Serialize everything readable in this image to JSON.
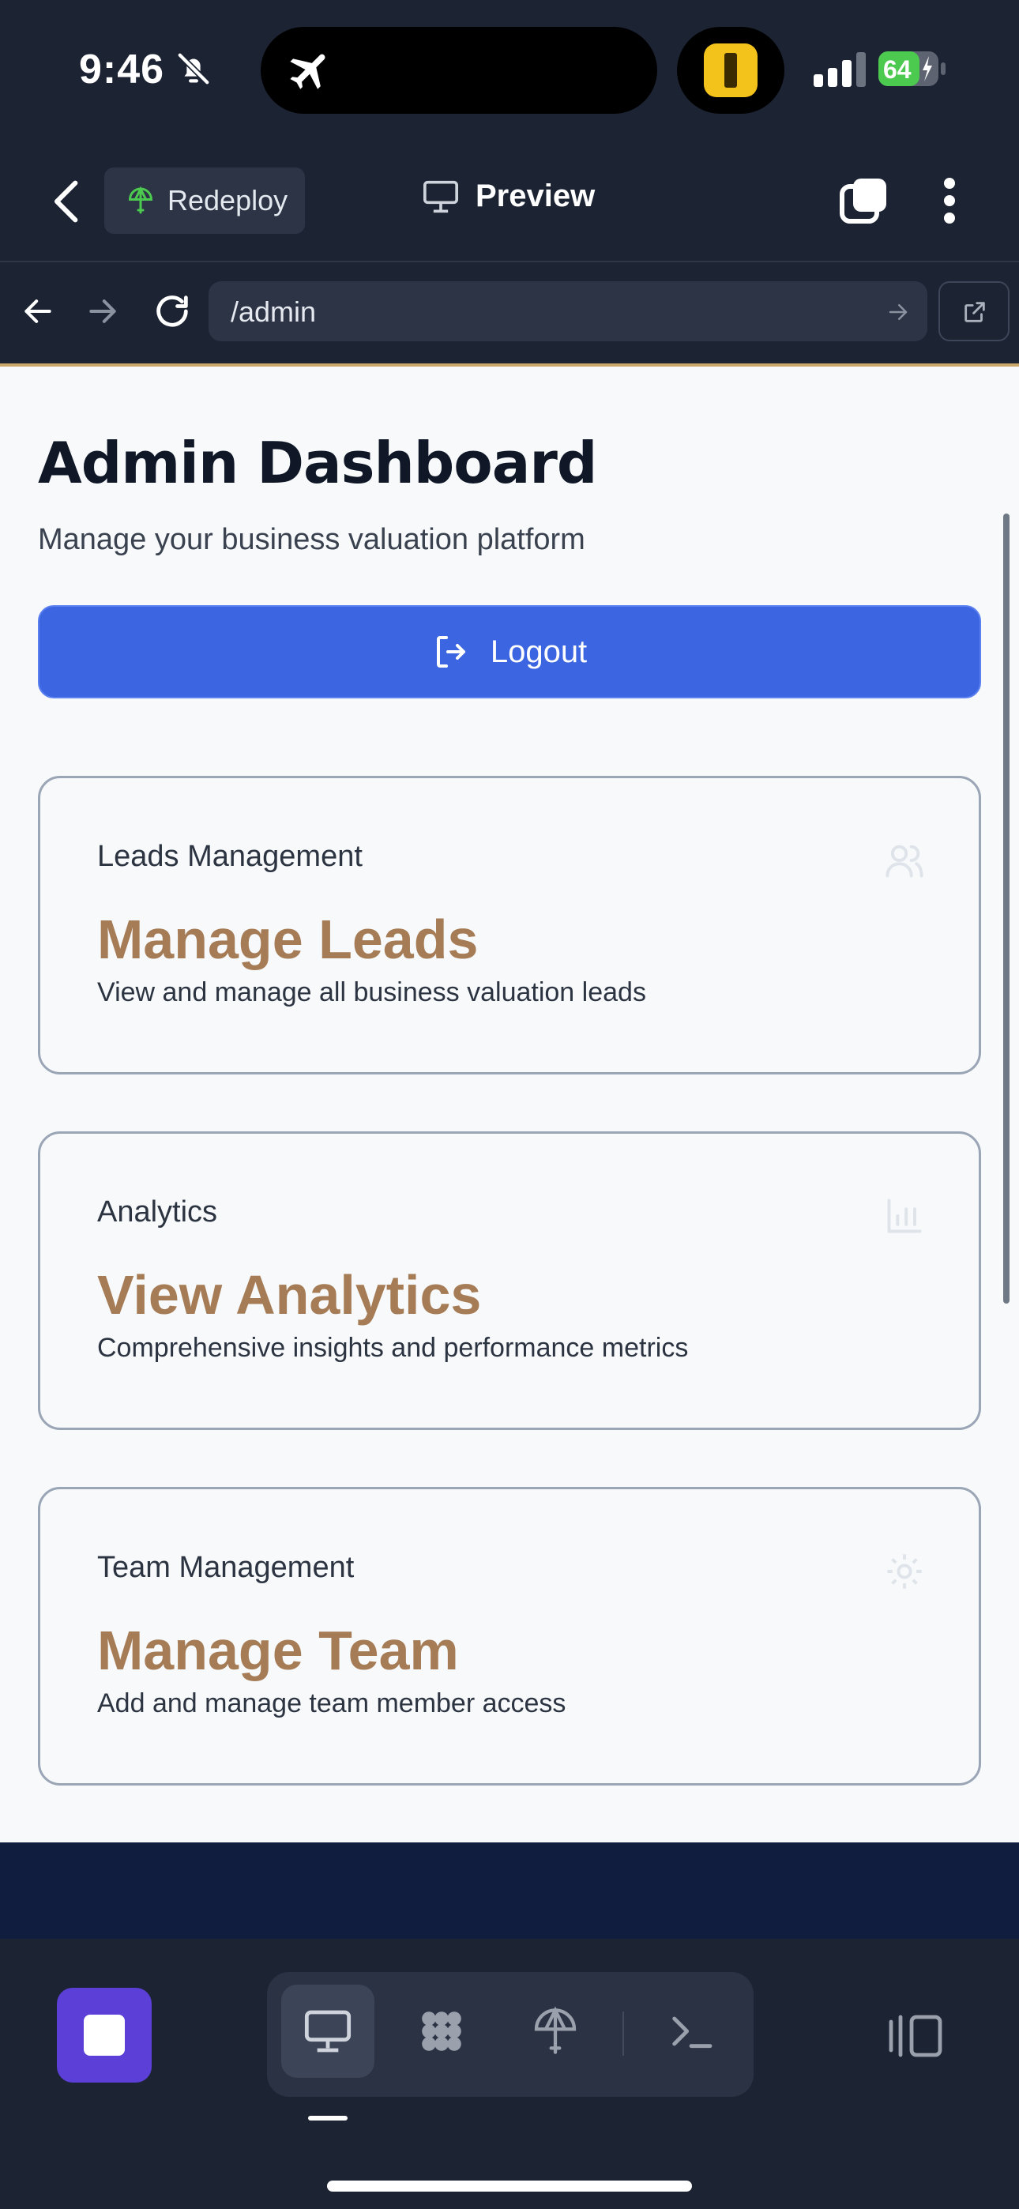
{
  "status_bar": {
    "time": "9:46",
    "battery": "64"
  },
  "header": {
    "redeploy_label": "Redeploy",
    "preview_label": "Preview"
  },
  "urlbar": {
    "url": "/admin"
  },
  "page": {
    "title": "Admin Dashboard",
    "subtitle": "Manage your business valuation platform",
    "logout_label": "Logout",
    "cards": [
      {
        "label": "Leads Management",
        "title": "Manage Leads",
        "desc": "View and manage all business valuation leads",
        "icon": "users-icon"
      },
      {
        "label": "Analytics",
        "title": "View Analytics",
        "desc": "Comprehensive insights and performance metrics",
        "icon": "bar-chart-icon"
      },
      {
        "label": "Team Management",
        "title": "Manage Team",
        "desc": "Add and manage team member access",
        "icon": "gear-icon"
      }
    ]
  },
  "toolbar": {
    "tools": [
      "desktop-icon",
      "grid-blob-icon",
      "deploy-icon",
      "terminal-icon"
    ],
    "active_tool": "desktop-icon"
  },
  "colors": {
    "accent": "#3b65e1",
    "brand_gold": "#a57c55",
    "stop": "#5b3fd6"
  }
}
